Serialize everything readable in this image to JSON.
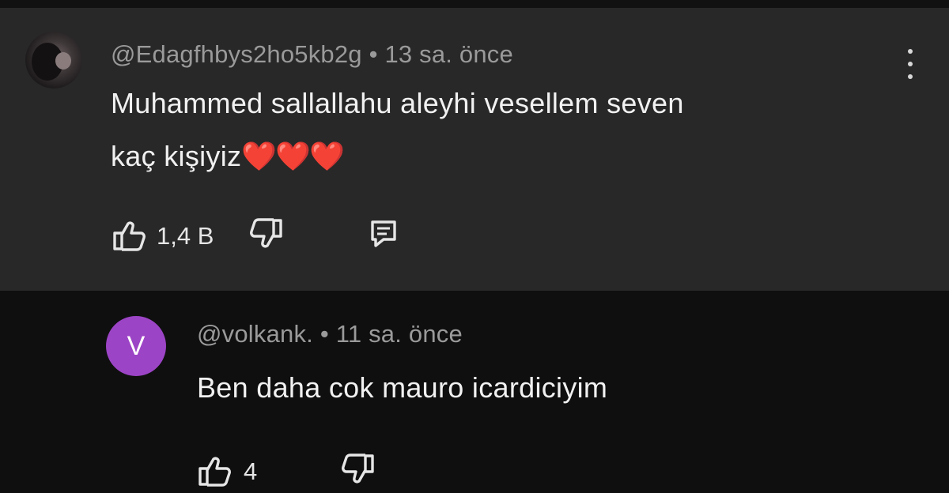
{
  "comments": [
    {
      "author": "@Edagfhbys2ho5kb2g",
      "separator": "•",
      "time": "13 sa. önce",
      "text_line1": "Muhammed sallallahu aleyhi vesellem seven",
      "text_line2": "kaç kişiyiz",
      "emoji": "❤️❤️❤️",
      "likes": "1,4 B",
      "avatar_icon": "profile-photo"
    },
    {
      "author": "@volkank.",
      "separator": "•",
      "time": "11 sa. önce",
      "avatar_letter": "V",
      "avatar_color": "#9c44c6",
      "text_line1": "Ben daha cok mauro icardiciyim",
      "likes": "4"
    }
  ],
  "icons": {
    "like": "thumb-up-icon",
    "dislike": "thumb-down-icon",
    "reply": "reply-comment-icon",
    "more": "more-vertical-icon"
  },
  "colors": {
    "highlighted_comment_bg": "#282828",
    "page_bg": "#0f0f0f",
    "heart": "#e01b2f"
  }
}
